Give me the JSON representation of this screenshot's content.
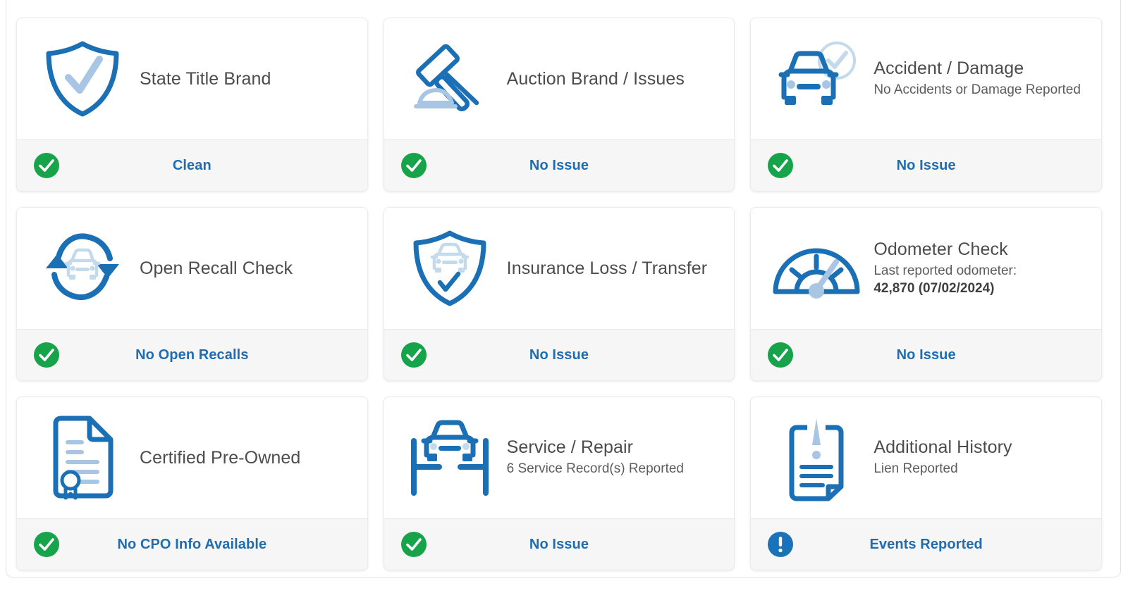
{
  "panel": {
    "accent_blue": "#1a6fb5",
    "link_blue": "#1f6cb0",
    "badge_green": "#16a34a",
    "badge_blue": "#1a72b8",
    "footer_bg": "#f6f6f6"
  },
  "cards": [
    {
      "icon": "shield-check-icon",
      "title": "State Title Brand",
      "subtitle": "",
      "subtitle_strong": "",
      "status_label": "Clean",
      "status_icon": "check-circle-icon",
      "status_type": "ok"
    },
    {
      "icon": "gavel-car-icon",
      "title": "Auction Brand / Issues",
      "subtitle": "",
      "subtitle_strong": "",
      "status_label": "No Issue",
      "status_icon": "check-circle-icon",
      "status_type": "ok"
    },
    {
      "icon": "car-check-icon",
      "title": "Accident / Damage",
      "subtitle": "No Accidents or Damage Reported",
      "subtitle_strong": "",
      "status_label": "No Issue",
      "status_icon": "check-circle-icon",
      "status_type": "ok"
    },
    {
      "icon": "recall-refresh-car-icon",
      "title": "Open Recall Check",
      "subtitle": "",
      "subtitle_strong": "",
      "status_label": "No Open Recalls",
      "status_icon": "check-circle-icon",
      "status_type": "ok"
    },
    {
      "icon": "shield-car-check-icon",
      "title": "Insurance Loss / Transfer",
      "subtitle": "",
      "subtitle_strong": "",
      "status_label": "No Issue",
      "status_icon": "check-circle-icon",
      "status_type": "ok"
    },
    {
      "icon": "odometer-gauge-icon",
      "title": "Odometer Check",
      "subtitle": "Last reported odometer:",
      "subtitle_strong": "42,870 (07/02/2024)",
      "status_label": "No Issue",
      "status_icon": "check-circle-icon",
      "status_type": "ok"
    },
    {
      "icon": "certificate-document-icon",
      "title": "Certified Pre-Owned",
      "subtitle": "",
      "subtitle_strong": "",
      "status_label": "No CPO Info Available",
      "status_icon": "check-circle-icon",
      "status_type": "ok"
    },
    {
      "icon": "car-lift-icon",
      "title": "Service / Repair",
      "subtitle": "6 Service Record(s) Reported",
      "subtitle_strong": "",
      "status_label": "No Issue",
      "status_icon": "check-circle-icon",
      "status_type": "ok"
    },
    {
      "icon": "clipboard-alert-icon",
      "title": "Additional History",
      "subtitle": "Lien Reported",
      "subtitle_strong": "",
      "status_label": "Events Reported",
      "status_icon": "exclamation-circle-icon",
      "status_type": "alert"
    }
  ]
}
